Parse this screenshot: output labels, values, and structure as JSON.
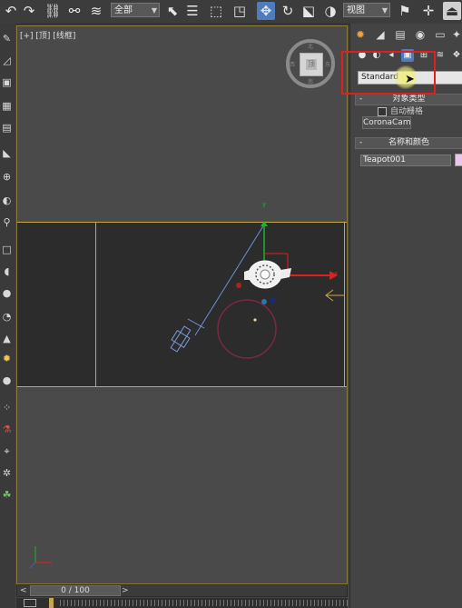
{
  "toolbar": {
    "selection_filter": "全部",
    "coord_system": "视图",
    "icons": [
      "undo-icon",
      "redo-icon",
      "link-icon",
      "unlink-icon",
      "bind-space-warp-icon",
      "select-icon",
      "select-by-name-icon",
      "rect-region-icon",
      "window-crossing-icon",
      "move-icon",
      "rotate-icon",
      "scale-icon",
      "select-place-icon",
      "pivot-icon",
      "mirror-icon",
      "align-icon",
      "layer-icon",
      "command-panel-icon"
    ]
  },
  "left_strip_icons": [
    "brush-icon",
    "ribbon-icon",
    "image-icon",
    "shape-icon",
    "light-icon",
    "camera-icon",
    "helper-icon",
    "spacewarp-icon",
    "box-icon",
    "sphere-icon",
    "cylinder-icon",
    "teapot-icon",
    "cone-icon",
    "torus-icon",
    "sun-icon",
    "plane-icon",
    "target-icon",
    "paint-icon",
    "particle-icon",
    "pin-icon",
    "wrench-icon"
  ],
  "viewport": {
    "label": "[+] [顶] [线框]",
    "viewcube_face": "顶",
    "viewcube_marks": {
      "n": "北",
      "s": "南",
      "e": "东",
      "w": "西"
    },
    "axis_x": "x",
    "axis_y": "y"
  },
  "timeline": {
    "frame_display": "0 / 100",
    "prev_arrow": "<",
    "next_arrow": ">"
  },
  "command_panel": {
    "tab_icons": [
      "create-icon",
      "modify-icon",
      "hierarchy-icon",
      "motion-icon",
      "display-icon",
      "utilities-icon"
    ],
    "category_icons": [
      "geometry-icon",
      "shapes-icon",
      "lights-icon",
      "cameras-icon",
      "helpers-icon",
      "spacewarps-icon",
      "systems-icon"
    ],
    "subcategory_dropdown": "Standard",
    "object_type_rollout": "对象类型",
    "autogrid_label": "自动栅格",
    "coronacam_button": "CoronaCam",
    "name_color_rollout": "名称和颜色",
    "object_name": "Teapot001",
    "object_color": "#e7c8e8"
  },
  "colors": {
    "highlight_box": "#e02020",
    "safe_frame": "#c8a84b",
    "camera_wire": "#6f8fd6",
    "gizmo_x": "#e02020",
    "gizmo_y": "#20b030",
    "target_circle": "#7a2848"
  }
}
